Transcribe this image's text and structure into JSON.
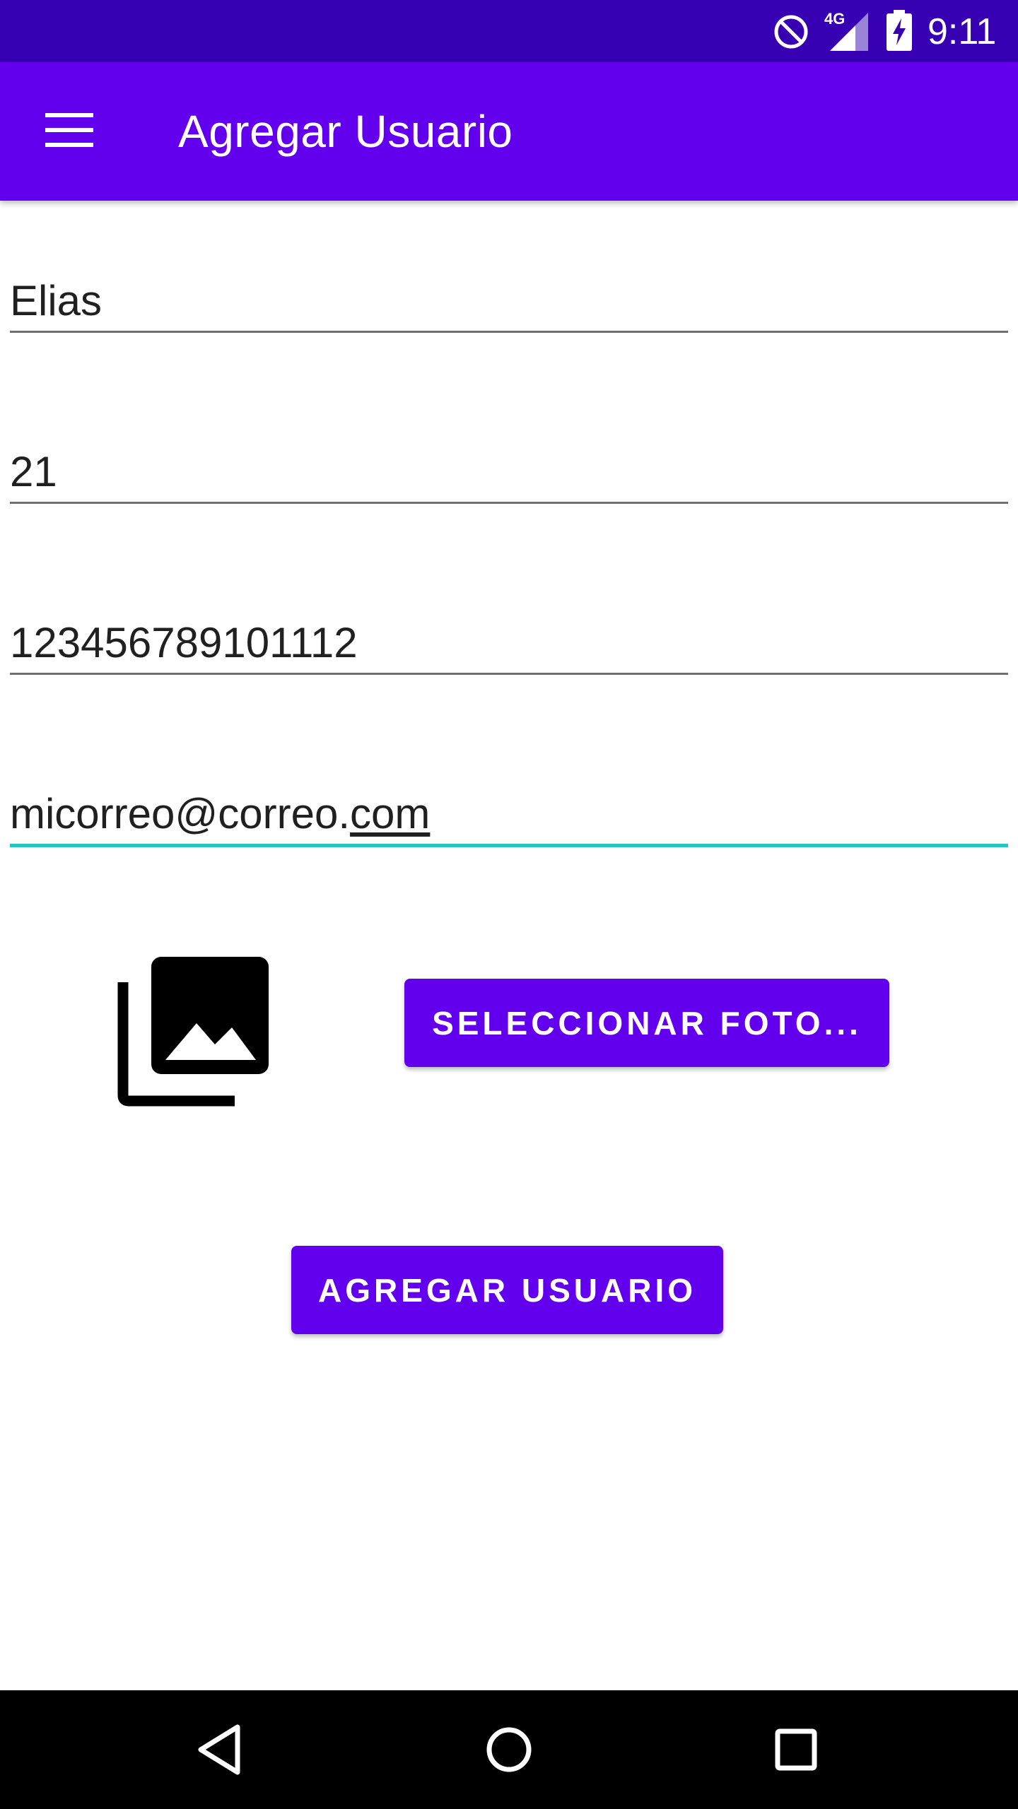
{
  "status_bar": {
    "network_type": "4G",
    "time": "9:11",
    "icons": [
      "do-not-disturb-icon",
      "signal-icon",
      "battery-charging-icon"
    ]
  },
  "app_bar": {
    "title": "Agregar Usuario",
    "menu_icon": "hamburger-menu-icon",
    "background": "#6200ee"
  },
  "form": {
    "name_value": "Elias",
    "age_value": "21",
    "phone_value": "123456789101112",
    "email_value_main": "micorreo@correo.",
    "email_value_underlined": "com",
    "focus_color": "#26c6c0"
  },
  "photo": {
    "icon": "photo-library-icon",
    "select_button_label": "SELECCIONAR FOTO..."
  },
  "actions": {
    "add_user_label": "AGREGAR USUARIO"
  },
  "nav_bar": {
    "icons": [
      "back-icon",
      "home-icon",
      "recents-icon"
    ]
  },
  "colors": {
    "status_bar": "#3700b3",
    "primary": "#6200ee",
    "accent": "#26c6c0"
  }
}
